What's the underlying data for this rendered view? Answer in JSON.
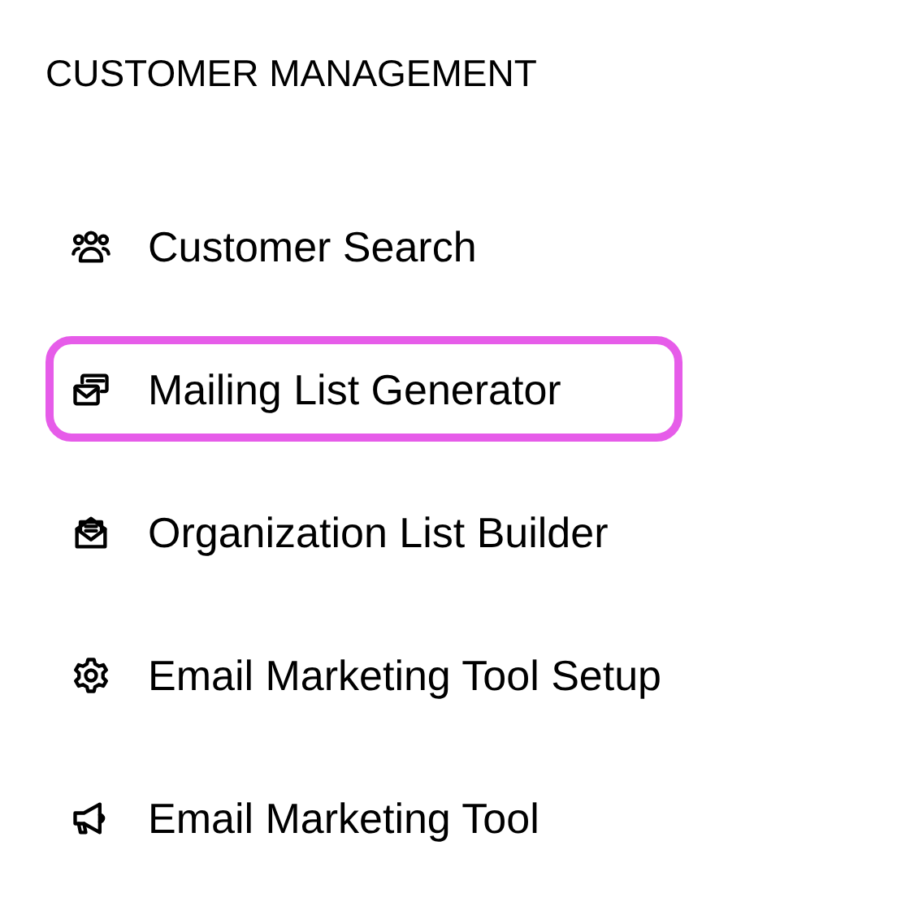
{
  "section": {
    "title": "CUSTOMER MANAGEMENT"
  },
  "items": [
    {
      "label": "Customer Search",
      "kind": "people",
      "selected": false
    },
    {
      "label": "Mailing List Generator",
      "kind": "mail-stack",
      "selected": true
    },
    {
      "label": "Organization List Builder",
      "kind": "open-mail",
      "selected": false
    },
    {
      "label": "Email Marketing Tool Setup",
      "kind": "gear",
      "selected": false
    },
    {
      "label": "Email Marketing Tool",
      "kind": "megaphone",
      "selected": false
    }
  ]
}
